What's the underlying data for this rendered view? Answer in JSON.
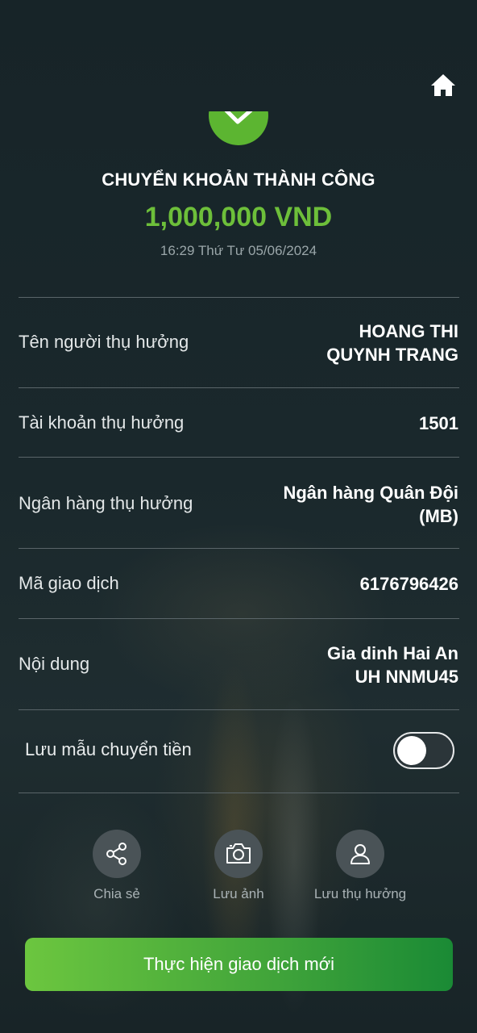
{
  "header": {
    "home_icon": "home-icon",
    "success_icon": "checkmark-icon"
  },
  "summary": {
    "title": "CHUYỂN KHOẢN THÀNH CÔNG",
    "amount": "1,000,000 VND",
    "datetime": "16:29 Thứ Tư 05/06/2024",
    "amount_color": "#6dbf3a"
  },
  "details": [
    {
      "label": "Tên người thụ hưởng",
      "value_line1": "HOANG THI",
      "value_line2": "QUYNH TRANG"
    },
    {
      "label": "Tài khoản thụ hưởng",
      "value_line1": "1501",
      "value_line2": ""
    },
    {
      "label": "Ngân hàng thụ hưởng",
      "value_line1": "Ngân hàng Quân Đội",
      "value_line2": "(MB)"
    },
    {
      "label": "Mã giao dịch",
      "value_line1": "6176796426",
      "value_line2": ""
    },
    {
      "label": "Nội dung",
      "value_line1": "Gia dinh Hai An",
      "value_line2": "UH NNMU45"
    }
  ],
  "save_template": {
    "label": "Lưu mẫu chuyển tiền",
    "enabled": false
  },
  "actions": [
    {
      "label": "Chia sẻ",
      "icon": "share-icon"
    },
    {
      "label": "Lưu ảnh",
      "icon": "camera-icon"
    },
    {
      "label": "Lưu thụ hưởng",
      "icon": "user-icon"
    }
  ],
  "primary_button": {
    "label": "Thực hiện giao dịch mới"
  },
  "colors": {
    "background": "#17252a",
    "accent_green": "#5cb531",
    "button_gradient_start": "#6cc63f",
    "button_gradient_end": "#1a8a35"
  }
}
